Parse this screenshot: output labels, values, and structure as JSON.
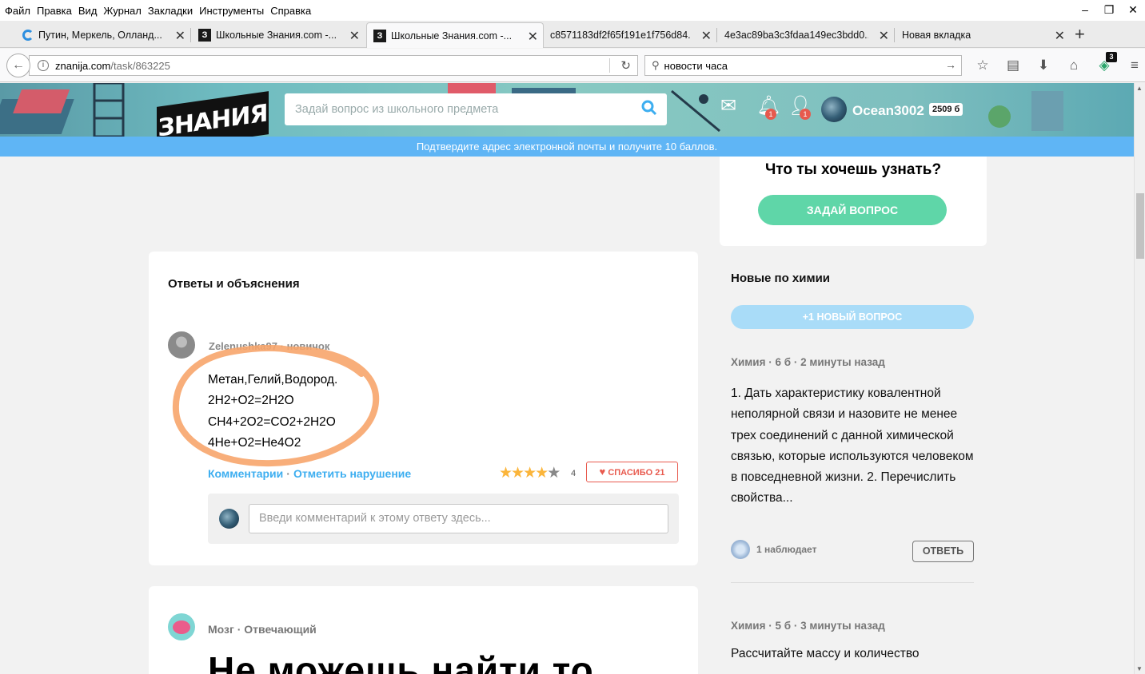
{
  "menu": [
    "Файл",
    "Правка",
    "Вид",
    "Журнал",
    "Закладки",
    "Инструменты",
    "Справка"
  ],
  "tabs": [
    {
      "label": "Путин, Меркель, Олланд...",
      "icon": "spinner-icon"
    },
    {
      "label": "Школьные Знания.com -...",
      "icon": "znanija-favicon"
    },
    {
      "label": "Школьные Знания.com -...",
      "icon": "znanija-favicon",
      "active": true
    },
    {
      "label": "c8571183df2f65f191e1f756d84...",
      "icon": ""
    },
    {
      "label": "4e3ac89ba3c3fdaa149ec3bdd0...",
      "icon": ""
    },
    {
      "label": "Новая вкладка",
      "icon": ""
    }
  ],
  "nav": {
    "url_host": "znanija.com",
    "url_path": "/task/863225",
    "search_value": "новости часа",
    "addon_badge": "3"
  },
  "site": {
    "logo": "ЗНАНИЯ",
    "search_placeholder": "Задай вопрос из школьного предмета",
    "notif_count": "1",
    "friends_count": "1",
    "username": "Ocean3002",
    "points": "2509 б",
    "confirm_banner": "Подтвердите адрес электронной почты и получите 10 баллов."
  },
  "ask": {
    "question": "Что ты хочешь узнать?",
    "button": "ЗАДАЙ ВОПРОС"
  },
  "answers": {
    "title": "Ответы и объяснения",
    "author": "Zelenushka97",
    "rank": "новичок",
    "lines": [
      "Метан,Гелий,Водород.",
      "2H2+O2=2H2O",
      "CH4+2O2=CO2+2H2O",
      "4He+O2=He4O2"
    ],
    "comments_link": "Комментарии",
    "report_link": "Отметить нарушение",
    "rating": 4,
    "rating_count": "4",
    "thanks": "СПАСИБО 21",
    "comment_placeholder": "Введи комментарий к этому ответу здесь..."
  },
  "second_card": {
    "author": "Мозг",
    "rank": "Отвечающий",
    "big_text": "Не можешь найти то"
  },
  "sidebar": {
    "title": "Новые по химии",
    "new_question": "+1 НОВЫЙ ВОПРОС",
    "q1_subject": "Химия",
    "q1_points": "6 б",
    "q1_time": "2 минуты назад",
    "q1_text": "1. Дать характеристику ковалентной неполярной связи и назовите не менее трех соединений с данной химической связью, которые используются человеком в повседневной жизни. 2. Перечислить свойства...",
    "q1_watchers": "1 наблюдает",
    "reply": "ОТВЕТЬ",
    "q2_subject": "Химия",
    "q2_points": "5 б",
    "q2_time": "3 минуты назад",
    "q2_text": "Рассчитайте массу и количество"
  },
  "colors": {
    "accent_blue": "#5fb5f5",
    "accent_green": "#5fd6a8",
    "link_blue": "#3daef0",
    "thanks_red": "#e85a4e",
    "star": "#fbb53b",
    "highlight_orange": "#f7a56b"
  }
}
